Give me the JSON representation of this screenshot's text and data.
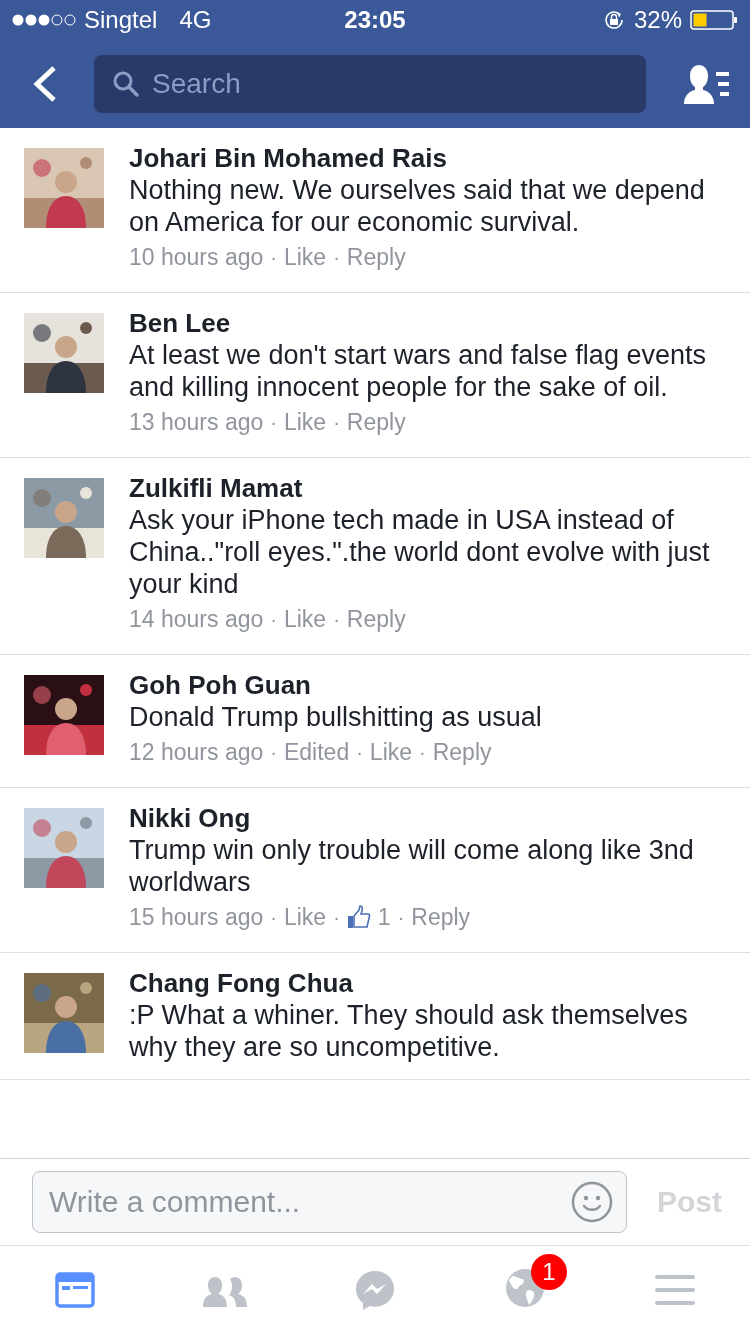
{
  "status_bar": {
    "carrier": "Singtel",
    "network": "4G",
    "time": "23:05",
    "battery": "32%"
  },
  "nav": {
    "search": {
      "placeholder": "Search"
    }
  },
  "separator": "·",
  "comments": [
    {
      "name": "Johari Bin Mohamed Rais",
      "text": "Nothing new. We ourselves said that we depend on America for our economic survival.",
      "meta": [
        {
          "kind": "time",
          "text": "10 hours ago"
        },
        {
          "kind": "link",
          "text": "Like"
        },
        {
          "kind": "link",
          "text": "Reply"
        }
      ]
    },
    {
      "name": "Ben Lee",
      "text": "At least we don't start wars and false flag events and killing innocent people for the sake of oil.",
      "meta": [
        {
          "kind": "time",
          "text": "13 hours ago"
        },
        {
          "kind": "link",
          "text": "Like"
        },
        {
          "kind": "link",
          "text": "Reply"
        }
      ]
    },
    {
      "name": "Zulkifli Mamat",
      "text": "Ask your iPhone tech made in USA instead of China..\"roll eyes.\".the world dont evolve with just your kind",
      "meta": [
        {
          "kind": "time",
          "text": "14 hours ago"
        },
        {
          "kind": "link",
          "text": "Like"
        },
        {
          "kind": "link",
          "text": "Reply"
        }
      ]
    },
    {
      "name": "Goh Poh Guan",
      "text": "Donald Trump bullshitting as usual",
      "meta": [
        {
          "kind": "time",
          "text": "12 hours ago"
        },
        {
          "kind": "label",
          "text": "Edited"
        },
        {
          "kind": "link",
          "text": "Like"
        },
        {
          "kind": "link",
          "text": "Reply"
        }
      ]
    },
    {
      "name": "Nikki Ong",
      "text": "Trump win only trouble will come along like 3nd worldwars",
      "meta": [
        {
          "kind": "time",
          "text": "15 hours ago"
        },
        {
          "kind": "link",
          "text": "Like"
        },
        {
          "kind": "likes",
          "text": "1"
        },
        {
          "kind": "link",
          "text": "Reply"
        }
      ]
    },
    {
      "name": "Chang Fong Chua",
      "text": ":P What a whiner. They should ask themselves why they are so uncompetitive."
    }
  ],
  "composer": {
    "placeholder": "Write a comment...",
    "post_button": {
      "label": "Post",
      "disabled": true
    }
  },
  "tab_bar": [
    {
      "kind": "feed",
      "selected": true
    },
    {
      "kind": "friends",
      "selected": false
    },
    {
      "kind": "messenger",
      "selected": false
    },
    {
      "kind": "globe",
      "selected": false,
      "badge": "1"
    },
    {
      "kind": "menu",
      "selected": false
    }
  ]
}
